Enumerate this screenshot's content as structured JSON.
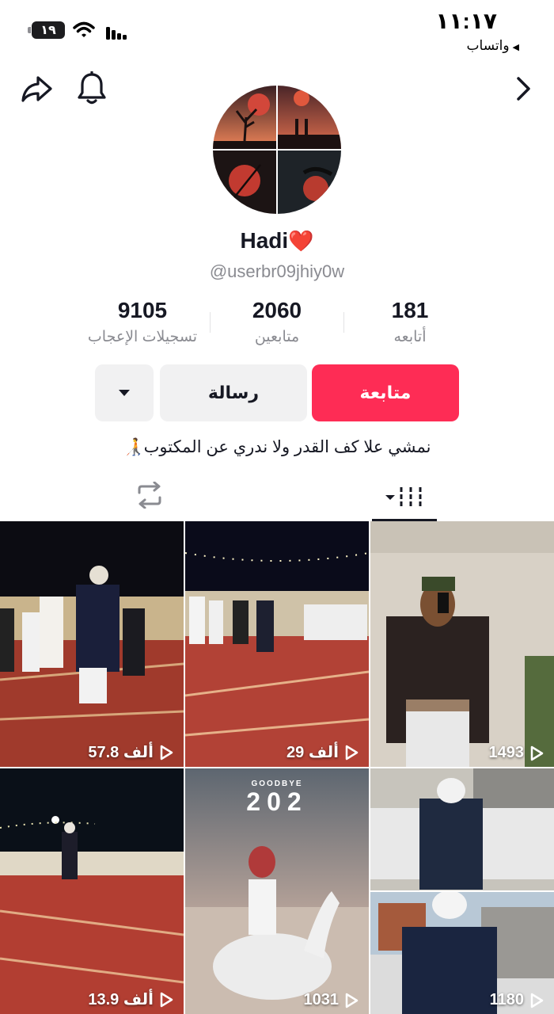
{
  "status_bar": {
    "time": "١١:١٧",
    "back_app": "واتساب",
    "battery": "١٩"
  },
  "profile": {
    "display_name": "Hadi",
    "name_emoji": "❤️",
    "username": "@userbr09jhiy0w",
    "bio": "نمشي علا كف القدر ولا ندري عن المكتوب🧑‍🦯"
  },
  "stats": {
    "following": {
      "value": "181",
      "label": "أتابعه"
    },
    "followers": {
      "value": "2060",
      "label": "متابعين"
    },
    "likes": {
      "value": "9105",
      "label": "تسجيلات الإعجاب"
    }
  },
  "buttons": {
    "follow": "متابعة",
    "message": "رسالة"
  },
  "videos": [
    {
      "views": "57.8 ألف"
    },
    {
      "views": "29 ألف"
    },
    {
      "views": "1493"
    },
    {
      "views": "13.9 ألف"
    },
    {
      "views": "1031",
      "overlay_top": "GOODBYE",
      "overlay_big": "202"
    },
    {
      "views": "1180"
    }
  ],
  "colors": {
    "accent": "#fe2c55",
    "text": "#161823",
    "muted": "#8a8b91",
    "button_bg": "#f1f1f2"
  },
  "icons": {
    "share": "share-icon",
    "bell": "bell-icon",
    "forward": "chevron-right-icon",
    "repost": "repost-icon",
    "videos_tab": "grid-icon",
    "play": "play-icon"
  }
}
